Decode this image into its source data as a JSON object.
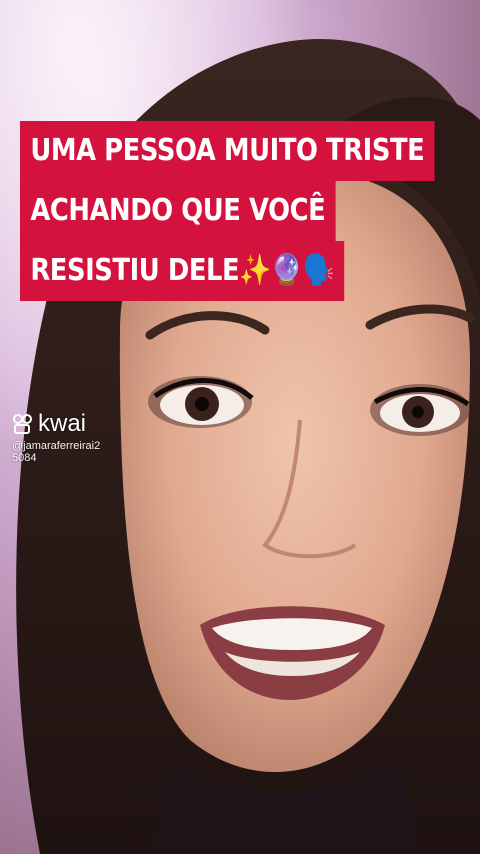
{
  "caption": {
    "line1": "UMA PESSOA MUITO TRISTE",
    "line2": "ACHANDO QUE VOCÊ",
    "line3": "RESISTIU DELE✨🔮🗣️"
  },
  "watermark": {
    "brand": "kwai",
    "brand_icon": "kwai-logo-icon",
    "handle_line1": "@jamaraferreirai2",
    "handle_line2": "5084"
  }
}
